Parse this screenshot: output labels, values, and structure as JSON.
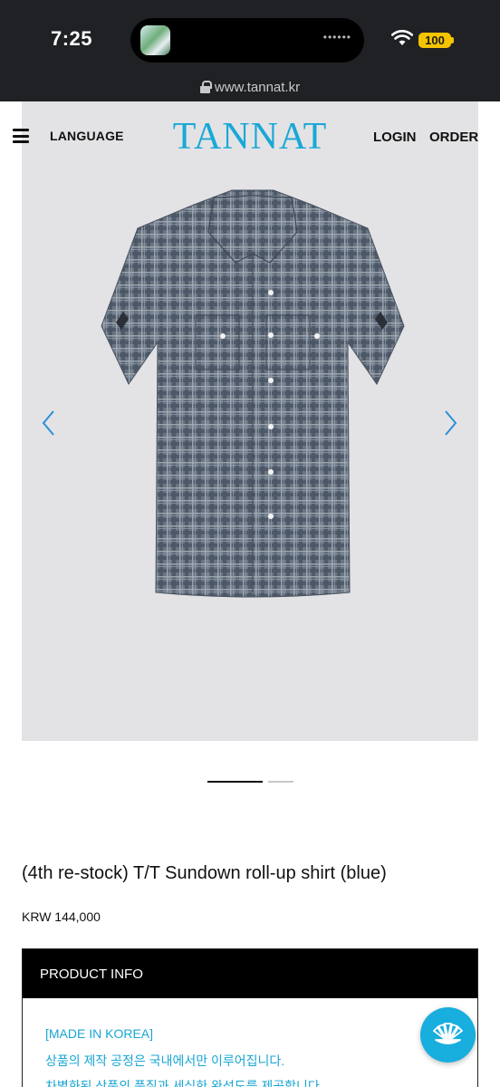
{
  "status_bar": {
    "time": "7:25",
    "battery": "100",
    "url": "www.tannat.kr"
  },
  "nav": {
    "language": "LANGUAGE",
    "logo": "TANNAT",
    "login": "LOGIN",
    "order": "ORDER"
  },
  "gallery": {
    "slide_count": 2,
    "active_slide": 1
  },
  "product": {
    "title": "(4th re-stock) T/T Sundown roll-up shirt (blue)",
    "price": "KRW 144,000"
  },
  "info": {
    "header": "PRODUCT INFO",
    "lines": [
      "[MADE IN KOREA]",
      "상품의 제작 공정은 국내에서만 이루어집니다.",
      "차별화된 상품의 품질과 세심한 완성도를 제공합니다."
    ]
  },
  "colors": {
    "brand": "#19a8d6",
    "status_bar_bg": "#1f2124",
    "hero_bg": "#e3e3e5",
    "battery": "#f5c400"
  },
  "icons": [
    "wifi-icon",
    "lock-icon",
    "hamburger-icon",
    "chevron-left-icon",
    "chevron-right-icon",
    "chat-icon"
  ]
}
